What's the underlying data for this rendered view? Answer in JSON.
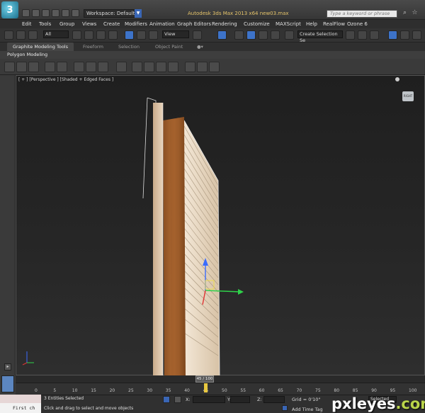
{
  "app": {
    "logo_letter": "3",
    "window_title": "Autodesk 3ds Max  2013 x64      new03.max",
    "workspace_label": "Workspace: Default",
    "search_placeholder": "Type a keyword or phrase"
  },
  "menu": [
    "Edit",
    "Tools",
    "Group",
    "Views",
    "Create",
    "Modifiers",
    "Animation",
    "Graph Editors",
    "Rendering",
    "Customize",
    "MAXScript",
    "Help",
    "RealFlow",
    "Ozone 6"
  ],
  "main_toolbar": {
    "selection_filter": "All",
    "reference_coord": "View",
    "named_selection": "Create Selection Se"
  },
  "ribbon": {
    "tabs": [
      "Graphite Modeling Tools",
      "Freeform",
      "Selection",
      "Object Paint"
    ],
    "active_tab": "Graphite Modeling Tools",
    "panel_label": "Polygon Modeling"
  },
  "viewport": {
    "label": "[ + ] [Perspective ] [Shaded + Edged Faces ]",
    "viewcube_label": "RIGHT"
  },
  "timeline": {
    "frame_display": "45 / 100",
    "current_frame": 45,
    "total_frames": 100,
    "ticks": [
      "0",
      "5",
      "10",
      "15",
      "20",
      "25",
      "30",
      "35",
      "40",
      "45",
      "50",
      "55",
      "60",
      "65",
      "70",
      "75",
      "80",
      "85",
      "90",
      "95",
      "100"
    ]
  },
  "status": {
    "maxscript_text": "First ch",
    "selection_info": "3 Entities Selected",
    "prompt": "Click and drag to select and move objects",
    "x_label": "X:",
    "y_label": "Y:",
    "z_label": "Z:",
    "grid": "Grid = 0'10\"",
    "add_time_tag": "Add Time Tag",
    "selected_dropdown": "Selected"
  },
  "watermark": {
    "text": "pxleyes",
    "suffix": ".com"
  },
  "colors": {
    "accent": "#3d73c9",
    "title_text": "#e4c36a"
  }
}
